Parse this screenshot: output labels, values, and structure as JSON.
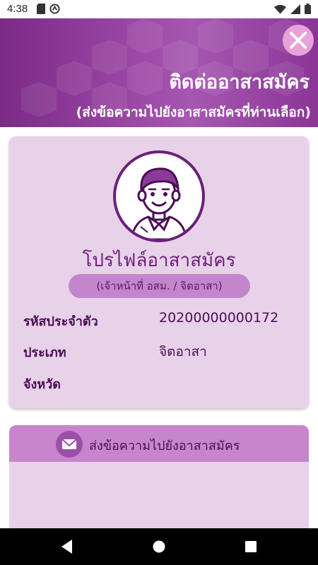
{
  "status_bar": {
    "time": "4:38"
  },
  "header": {
    "title": "ติดต่ออาสาสมัคร",
    "subtitle": "(ส่งข้อความไปยังอาสาสมัครที่ท่านเลือก)",
    "background_color": "#9a46a4"
  },
  "profile": {
    "title": "โปรไฟล์อาสาสมัคร",
    "role_pill": "(เจ้าหน้าที่ อสม. / จิตอาสา)",
    "fields": [
      {
        "label": "รหัสประจำตัว",
        "value": "20200000000172"
      },
      {
        "label": "ประเภท",
        "value": "จิตอาสา"
      },
      {
        "label": "จังหวัด",
        "value": ""
      }
    ]
  },
  "message": {
    "label": "ส่งข้อความไปยังอาสาสมัคร"
  },
  "colors": {
    "accent": "#6a2078",
    "card_bg": "#e8d2e9",
    "pill_bg": "#c386cc"
  },
  "icons": [
    "close-icon",
    "avatar-icon",
    "mail-icon",
    "back-icon",
    "home-icon",
    "recents-icon",
    "wifi-icon",
    "battery-icon",
    "signal-icon"
  ]
}
